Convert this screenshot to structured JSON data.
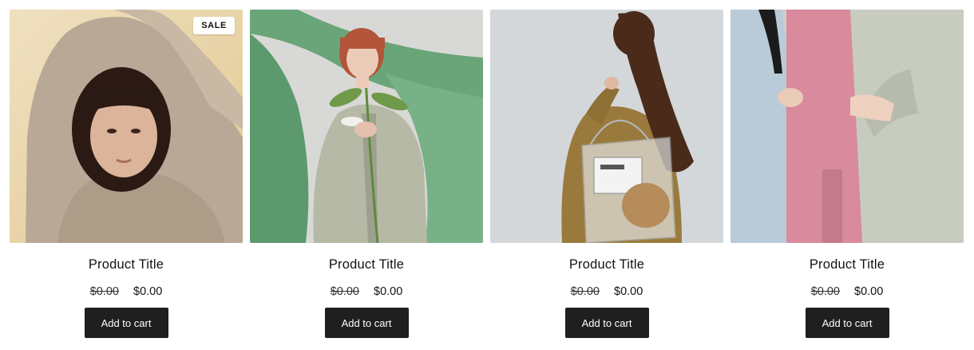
{
  "products": [
    {
      "title": "Product Title",
      "compare_price": "$0.00",
      "price": "$0.00",
      "button_label": "Add to cart",
      "badge": "SALE",
      "image": "woman in beige knit sweater with arms raised"
    },
    {
      "title": "Product Title",
      "compare_price": "$0.00",
      "price": "$0.00",
      "button_label": "Add to cart",
      "image": "red-haired woman in sage blazer holding lily against green fabric"
    },
    {
      "title": "Product Title",
      "compare_price": "$0.00",
      "price": "$0.00",
      "button_label": "Add to cart",
      "image": "woman with long wavy hair carrying a clear tote bag"
    },
    {
      "title": "Product Title",
      "compare_price": "$0.00",
      "price": "$0.00",
      "button_label": "Add to cart",
      "image": "three people in pastel blazers, arms linked"
    }
  ],
  "colors": {
    "button_bg": "#1f1f1f",
    "button_text": "#ffffff",
    "badge_bg": "#ffffff",
    "text": "#121212"
  }
}
